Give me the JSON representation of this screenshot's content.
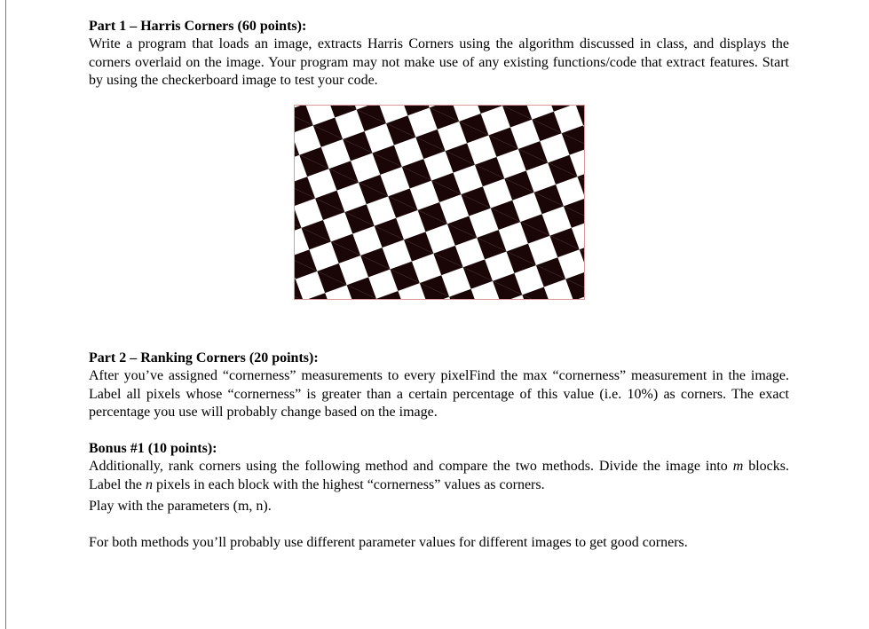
{
  "part1": {
    "heading": "Part 1 – Harris Corners (60 points):",
    "body": "Write a program that loads an image, extracts Harris Corners using the algorithm discussed in class, and displays the corners overlaid on the image.  Your program may not make use of any existing functions/code that extract features.  Start by using the checkerboard image to test your code."
  },
  "figure": {
    "alt": "Rotated black-and-white checkerboard test image"
  },
  "part2": {
    "heading": "Part 2 – Ranking Corners (20 points):",
    "body": "After you’ve assigned “cornerness” measurements to every pixelFind the max “cornerness” measurement in the image.  Label all pixels whose “cornerness” is greater than a certain percentage of this value (i.e. 10%) as corners.  The exact percentage you use will probably change based on the image."
  },
  "bonus1": {
    "heading": "Bonus #1 (10 points):",
    "line1_pre": "Additionally, rank corners using the following method and compare the two methods.  Divide the image into ",
    "m": "m",
    "line1_mid": " blocks.  Label the ",
    "n": "n",
    "line1_post": " pixels in each block with the highest “cornerness” values as corners.",
    "line2": "Play with the parameters (m, n).",
    "line3": "For both methods you’ll probably use different parameter values for different images to get good corners."
  }
}
